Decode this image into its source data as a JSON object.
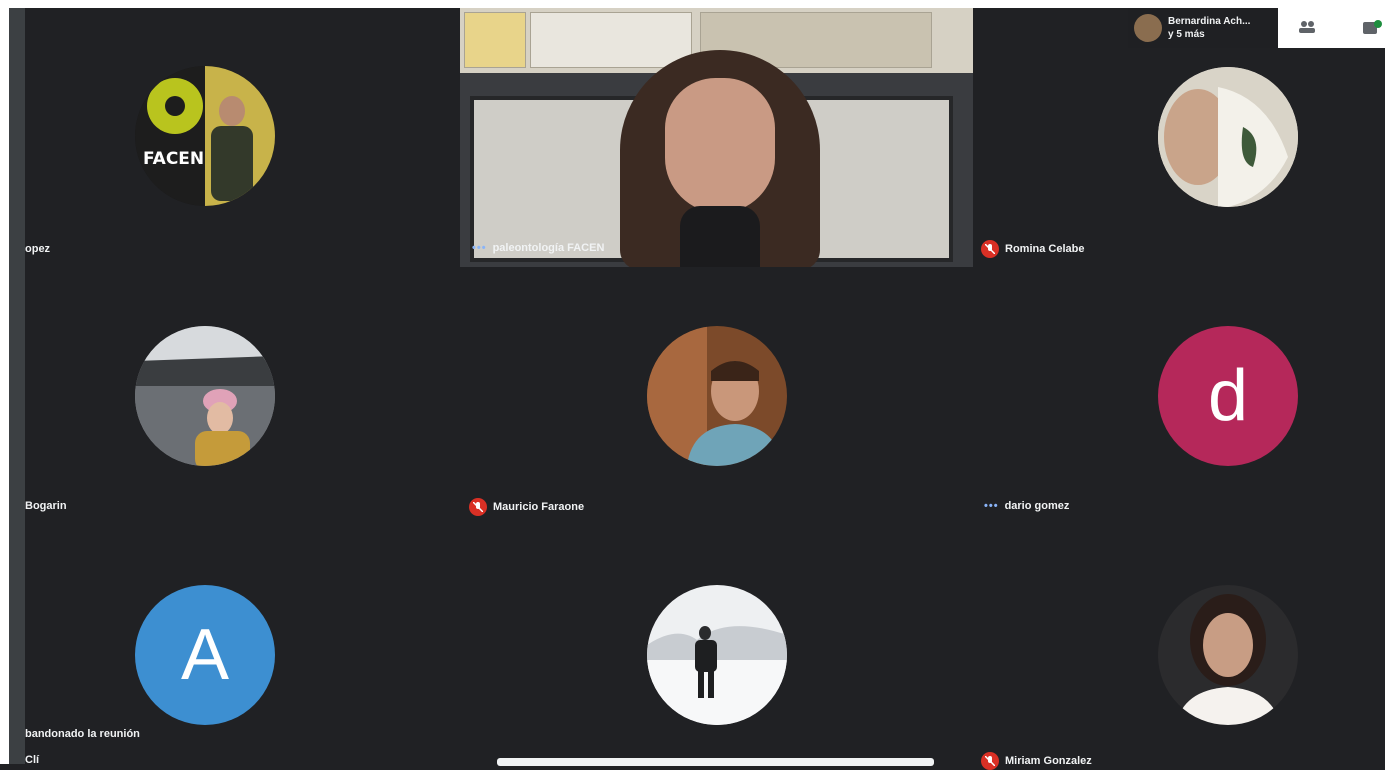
{
  "chip": {
    "line1": "Bernardina Ach...",
    "line2": "y 5 más"
  },
  "white_panel": {
    "icon1": "people-icon",
    "icon2": "chat-icon"
  },
  "presenter": {
    "name": "paleontología FACEN",
    "logo_text": "FACEN"
  },
  "participants": [
    {
      "name": "opez",
      "muted": false
    },
    {
      "name": "Romina Celabe",
      "muted": true
    },
    {
      "name": "Bogarin",
      "muted": false
    },
    {
      "name": "Mauricio Faraone",
      "muted": true
    },
    {
      "name": "dario gomez",
      "muted": false,
      "initial": "d",
      "avatar_color": "#b5285a"
    },
    {
      "name": "bandonado la reunión",
      "muted": false,
      "initial": "A",
      "avatar_color": "#3d8fd1"
    },
    {
      "name": "Miriam Gonzalez",
      "muted": true
    }
  ],
  "bottom_left_partial": "Clí",
  "colors": {
    "background": "#202124",
    "mute": "#d93025",
    "speaking_dots": "#8ab4f8"
  }
}
